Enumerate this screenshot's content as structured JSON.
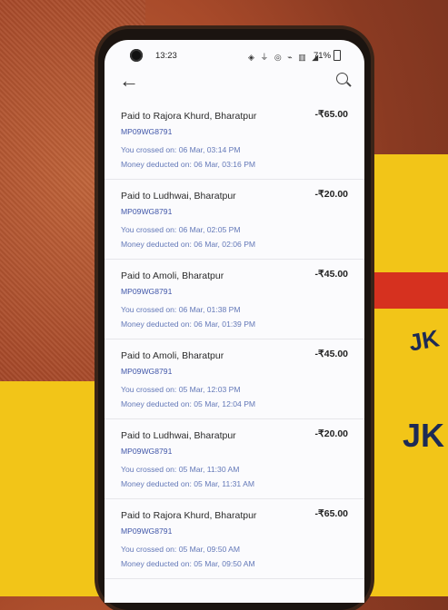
{
  "status_bar": {
    "time": "13:23",
    "icons": "◈ ⏚ ◎ ⌁ ▥ ◢",
    "battery": "71%"
  },
  "header": {
    "back_icon": "back-arrow-icon",
    "search_icon": "search-icon"
  },
  "transactions": [
    {
      "title": "Paid to Rajora Khurd, Bharatpur",
      "amount": "-₹65.00",
      "vehicle": "MP09WG8791",
      "crossed": "You crossed on: 06 Mar, 03:14 PM",
      "deducted": "Money deducted on: 06 Mar, 03:16 PM"
    },
    {
      "title": "Paid to Ludhwai, Bharatpur",
      "amount": "-₹20.00",
      "vehicle": "MP09WG8791",
      "crossed": "You crossed on: 06 Mar, 02:05 PM",
      "deducted": "Money deducted on: 06 Mar, 02:06 PM"
    },
    {
      "title": "Paid to Amoli, Bharatpur",
      "amount": "-₹45.00",
      "vehicle": "MP09WG8791",
      "crossed": "You crossed on: 06 Mar, 01:38 PM",
      "deducted": "Money deducted on: 06 Mar, 01:39 PM"
    },
    {
      "title": "Paid to Amoli, Bharatpur",
      "amount": "-₹45.00",
      "vehicle": "MP09WG8791",
      "crossed": "You crossed on: 05 Mar, 12:03 PM",
      "deducted": "Money deducted on: 05 Mar, 12:04 PM"
    },
    {
      "title": "Paid to Ludhwai, Bharatpur",
      "amount": "-₹20.00",
      "vehicle": "MP09WG8791",
      "crossed": "You crossed on: 05 Mar, 11:30 AM",
      "deducted": "Money deducted on: 05 Mar, 11:31 AM"
    },
    {
      "title": "Paid to Rajora Khurd, Bharatpur",
      "amount": "-₹65.00",
      "vehicle": "MP09WG8791",
      "crossed": "You crossed on: 05 Mar, 09:50 AM",
      "deducted": "Money deducted on: 05 Mar, 09:50 AM"
    }
  ],
  "background": {
    "bag_text_1": "JK",
    "bag_text_2": "JK"
  }
}
